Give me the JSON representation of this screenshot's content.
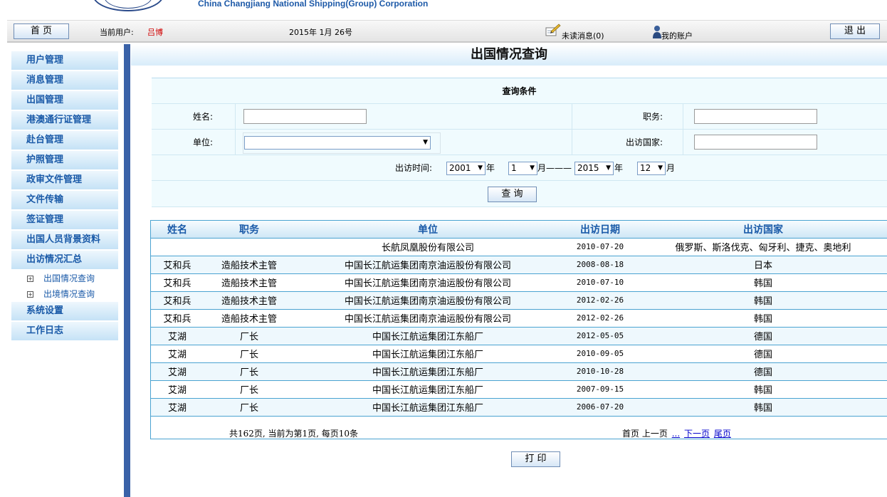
{
  "header": {
    "company_en": "China Changjiang National Shipping(Group) Corporation",
    "home_label": "首 页",
    "current_user_label": "当前用户:",
    "current_user": "吕博",
    "date": "2015年 1月 26号",
    "unread_messages": "未读消息(0)",
    "my_account": "我的账户",
    "logout_label": "退 出",
    "accent_color": "#3a62a8",
    "icons": [
      "pencil-message-icon",
      "user-account-icon"
    ]
  },
  "sidebar": {
    "items": [
      "用户管理",
      "消息管理",
      "出国管理",
      "港澳通行证管理",
      "赴台管理",
      "护照管理",
      "政审文件管理",
      "文件传输",
      "签证管理",
      "出国人员背景资料",
      "出访情况汇总"
    ],
    "sub_items": [
      "出国情况查询",
      "出境情况查询"
    ],
    "items_after": [
      "系统设置",
      "工作日志"
    ]
  },
  "main": {
    "page_title": "出国情况查询",
    "query": {
      "title": "查询条件",
      "name_label": "姓名:",
      "name_value": "",
      "position_label": "职务:",
      "position_value": "",
      "unit_label": "单位:",
      "unit_value": "",
      "country_label": "出访国家:",
      "country_value": "",
      "time_label": "出访时间:",
      "from_year": "2001",
      "from_month": "1",
      "to_year": "2015",
      "to_month": "12",
      "year_suffix": "年",
      "month_suffix": "月",
      "range_sep": "月———",
      "button": "查 询"
    },
    "table": {
      "headers": [
        "姓名",
        "职务",
        "单位",
        "出访日期",
        "出访国家"
      ],
      "rows": [
        [
          "",
          "",
          "长航凤凰股份有限公司",
          "2010-07-20",
          "俄罗斯、斯洛伐克、匈牙利、捷克、奥地利"
        ],
        [
          "艾和兵",
          "造船技术主管",
          "中国长江航运集团南京油运股份有限公司",
          "2008-08-18",
          "日本"
        ],
        [
          "艾和兵",
          "造船技术主管",
          "中国长江航运集团南京油运股份有限公司",
          "2010-07-10",
          "韩国"
        ],
        [
          "艾和兵",
          "造船技术主管",
          "中国长江航运集团南京油运股份有限公司",
          "2012-02-26",
          "韩国"
        ],
        [
          "艾和兵",
          "造船技术主管",
          "中国长江航运集团南京油运股份有限公司",
          "2012-02-26",
          "韩国"
        ],
        [
          "艾湖",
          "厂长",
          "中国长江航运集团江东船厂",
          "2012-05-05",
          "德国"
        ],
        [
          "艾湖",
          "厂长",
          "中国长江航运集团江东船厂",
          "2010-09-05",
          "德国"
        ],
        [
          "艾湖",
          "厂长",
          "中国长江航运集团江东船厂",
          "2010-10-28",
          "德国"
        ],
        [
          "艾湖",
          "厂长",
          "中国长江航运集团江东船厂",
          "2007-09-15",
          "韩国"
        ],
        [
          "艾湖",
          "厂长",
          "中国长江航运集团江东船厂",
          "2006-07-20",
          "韩国"
        ]
      ]
    },
    "pager": {
      "summary": "共162页, 当前为第1页, 每页10条",
      "first": "首页",
      "prev": "上一页",
      "ellipsis": "...",
      "next": "下一页",
      "last": "尾页"
    },
    "print_button": "打 印"
  }
}
